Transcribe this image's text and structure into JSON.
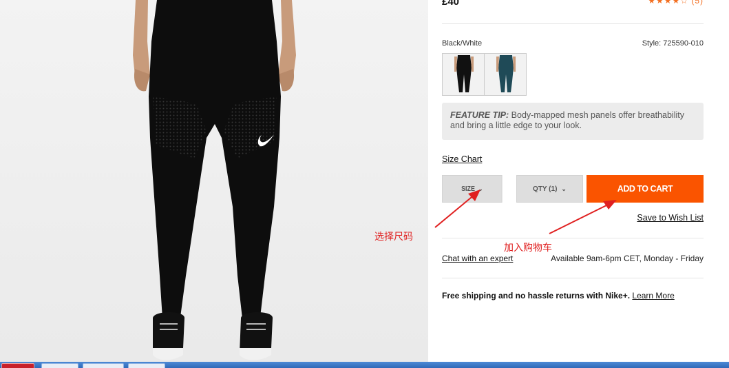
{
  "product": {
    "price": "£40",
    "rating_stars": "★★★★☆",
    "rating_count": "(5)",
    "color_name": "Black/White",
    "style_number": "Style: 725590-010",
    "swatch_colors": [
      "#111111",
      "#1f4a57"
    ],
    "feature_tip_label": "FEATURE TIP:",
    "feature_tip_text": " Body-mapped mesh panels offer breathability and bring a little edge to your look.",
    "size_chart_label": "Size Chart",
    "size_label": "SIZE",
    "qty_label": "QTY (1)",
    "add_to_cart_label": "ADD TO CART",
    "wish_list_label": "Save to Wish List",
    "chat_label": "Chat with an expert",
    "availability": "Available 9am-6pm CET, Monday - Friday",
    "shipping_text": "Free shipping and no hassle returns with Nike+.",
    "learn_more_label": "Learn More"
  },
  "annotations": {
    "select_size": "选择尺码",
    "add_to_cart": "加入购物车"
  },
  "colors": {
    "accent": "#fa5400",
    "annotation": "#e02020"
  }
}
